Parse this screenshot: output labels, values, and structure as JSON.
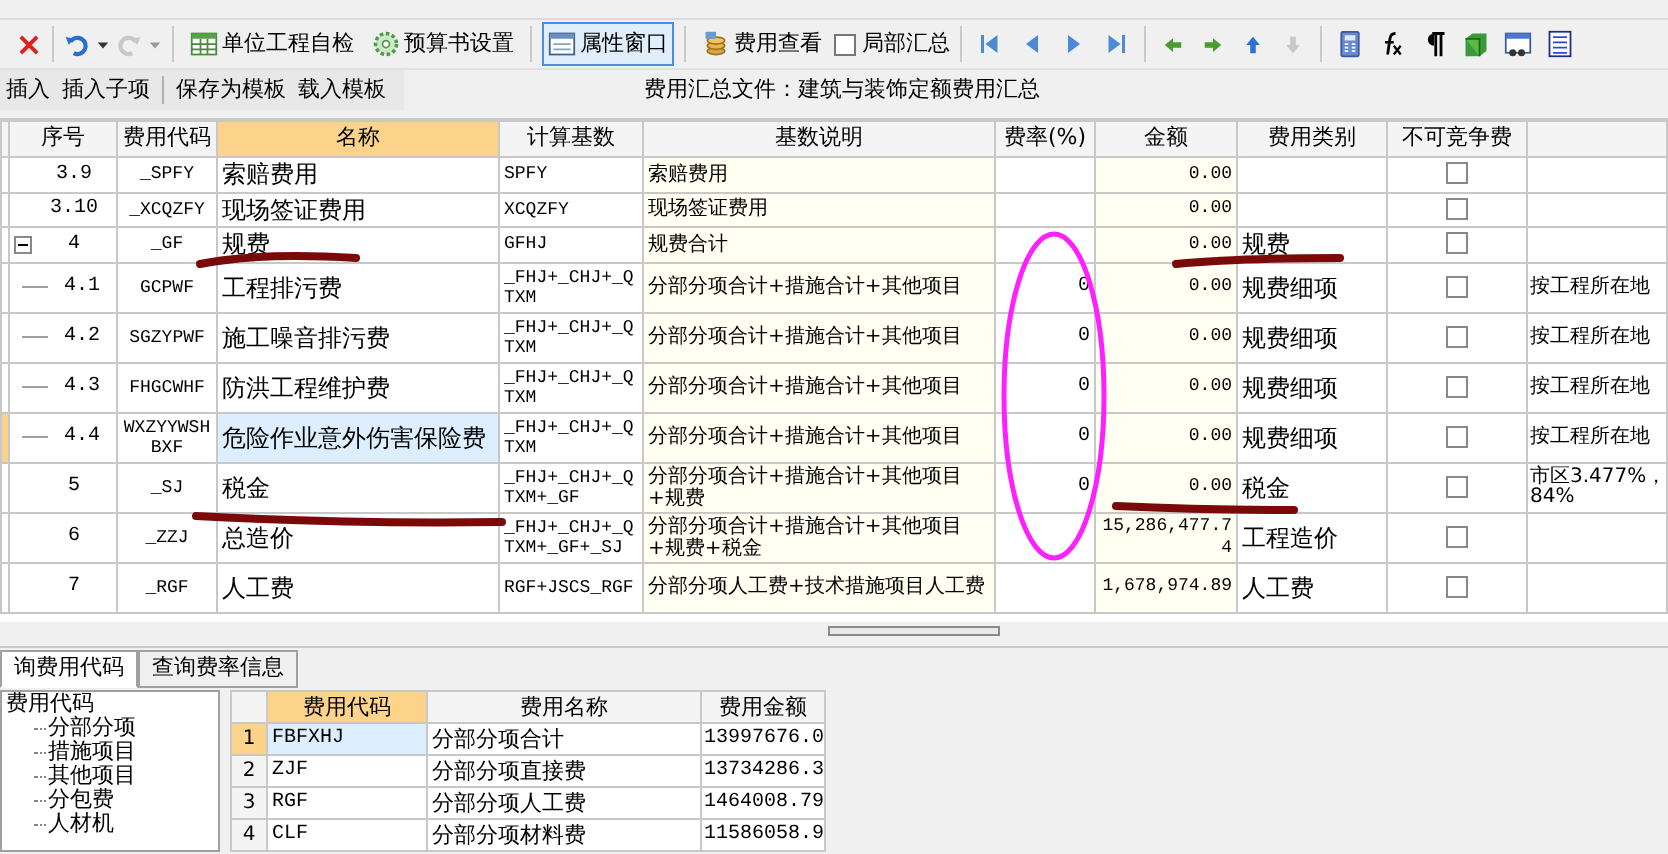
{
  "toolbar": {
    "buttons": [
      {
        "label": "单位工程自检",
        "selected": false
      },
      {
        "label": "预算书设置",
        "selected": false
      },
      {
        "label": "属性窗口",
        "selected": true
      },
      {
        "label": "费用查看",
        "selected": false
      }
    ],
    "checkbox": {
      "label": "局部汇总",
      "checked": false
    }
  },
  "subtoolbar": {
    "buttons": [
      "插入",
      "插入子项",
      "保存为模板",
      "载入模板"
    ],
    "title": "费用汇总文件：建筑与装饰定额费用汇总"
  },
  "table": {
    "columns": [
      {
        "label": "序号",
        "selected": false
      },
      {
        "label": "费用代码",
        "selected": false
      },
      {
        "label": "名称",
        "selected": true
      },
      {
        "label": "计算基数",
        "selected": false
      },
      {
        "label": "基数说明",
        "selected": false
      },
      {
        "label": "费率(%)",
        "selected": false
      },
      {
        "label": "金额",
        "selected": false
      },
      {
        "label": "费用类别",
        "selected": false
      },
      {
        "label": "不可竞争费",
        "selected": false
      }
    ],
    "rows": [
      {
        "no": "3.9",
        "code": "_SPFY",
        "name": "索赔费用",
        "base": "SPFY",
        "base_desc": "索赔费用",
        "amount": "0.00",
        "non_competitive": false,
        "selected": false
      },
      {
        "no": "3.10",
        "code": "_XCQZFY",
        "name": "现场签证费用",
        "base": "XCQZFY",
        "base_desc": "现场签证费用",
        "amount": "0.00",
        "non_competitive": false,
        "selected": false
      },
      {
        "no": "4",
        "code": "_GF",
        "name": "规费",
        "base": "GFHJ",
        "base_desc": "规费合计",
        "amount": "0.00",
        "category": "规费",
        "non_competitive": false,
        "selected": false,
        "expanded": true,
        "children": [
          {
            "no": "4.1",
            "code": "GCPWF",
            "name": "工程排污费",
            "base": "_FHJ+_CHJ+_QTXM",
            "base_desc": "分部分项合计+措施合计+其他项目",
            "rate": "0",
            "amount": "0.00",
            "category": "规费细项",
            "non_competitive": false,
            "note": "按工程所在地",
            "selected": false
          },
          {
            "no": "4.2",
            "code": "SGZYPWF",
            "name": "施工噪音排污费",
            "base": "_FHJ+_CHJ+_QTXM",
            "base_desc": "分部分项合计+措施合计+其他项目",
            "rate": "0",
            "amount": "0.00",
            "category": "规费细项",
            "non_competitive": false,
            "note": "按工程所在地",
            "selected": false
          },
          {
            "no": "4.3",
            "code": "FHGCWHF",
            "name": "防洪工程维护费",
            "base": "_FHJ+_CHJ+_QTXM",
            "base_desc": "分部分项合计+措施合计+其他项目",
            "rate": "0",
            "amount": "0.00",
            "category": "规费细项",
            "non_competitive": false,
            "note": "按工程所在地",
            "selected": false
          },
          {
            "no": "4.4",
            "code": "WXZYYWSHBXF",
            "name": "危险作业意外伤害保险费",
            "base": "_FHJ+_CHJ+_QTXM",
            "base_desc": "分部分项合计+措施合计+其他项目",
            "rate": "0",
            "amount": "0.00",
            "category": "规费细项",
            "non_competitive": false,
            "note": "按工程所在地",
            "selected": true
          }
        ]
      },
      {
        "no": "5",
        "code": "_SJ",
        "name": "税金",
        "base": "_FHJ+_CHJ+_QTXM+_GF",
        "base_desc": "分部分项合计+措施合计+其他项目+规费",
        "rate": "0",
        "amount": "0.00",
        "category": "税金",
        "non_competitive": false,
        "note": "市区3.477%，\n84%",
        "selected": false
      },
      {
        "no": "6",
        "code": "_ZZJ",
        "name": "总造价",
        "base": "_FHJ+_CHJ+_QTXM+_GF+_SJ",
        "base_desc": "分部分项合计+措施合计+其他项目+规费+税金",
        "amount": "15,286,477.74",
        "category": "工程造价",
        "non_competitive": false,
        "selected": false
      },
      {
        "no": "7",
        "code": "_RGF",
        "name": "人工费",
        "base": "RGF+JSCS_RGF",
        "base_desc": "分部分项人工费+技术措施项目人工费",
        "amount": "1,678,974.89",
        "category": "人工费",
        "non_competitive": false,
        "selected": false
      }
    ]
  },
  "bottom_tabs": [
    {
      "label": "询费用代码",
      "selected": true
    },
    {
      "label": "查询费率信息",
      "selected": false
    }
  ],
  "code_tree": [
    {
      "label": "费用代码",
      "children": [
        {
          "label": "分部分项"
        },
        {
          "label": "措施项目"
        },
        {
          "label": "其他项目"
        },
        {
          "label": "分包费"
        },
        {
          "label": "人材机"
        }
      ]
    }
  ],
  "code_table": {
    "columns": [
      "费用代码",
      "费用名称",
      "费用金额"
    ],
    "rows": [
      {
        "index": "1",
        "code": "FBFXHJ",
        "name": "分部分项合计",
        "amount": "13997676.0",
        "selected": true
      },
      {
        "index": "2",
        "code": "ZJF",
        "name": "分部分项直接费",
        "amount": "13734286.3",
        "selected": false
      },
      {
        "index": "3",
        "code": "RGF",
        "name": "分部分项人工费",
        "amount": "1464008.79",
        "selected": false
      },
      {
        "index": "4",
        "code": "CLF",
        "name": "分部分项材料费",
        "amount": "11586058.9",
        "selected": false
      }
    ]
  }
}
